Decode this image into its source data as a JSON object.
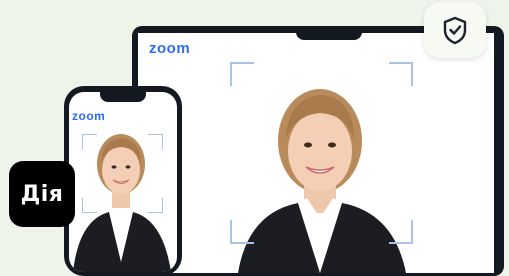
{
  "laptop": {
    "logo_text": "zoom"
  },
  "phone": {
    "logo_text": "zoom"
  },
  "app_badge": {
    "label": "Дія"
  },
  "icons": {
    "security": "shield-check-icon"
  },
  "colors": {
    "background": "#eef4ea",
    "device_frame": "#141821",
    "zoom_blue": "#2d6cf6",
    "face_frame": "#a7c3e6",
    "badge": "#000000"
  }
}
